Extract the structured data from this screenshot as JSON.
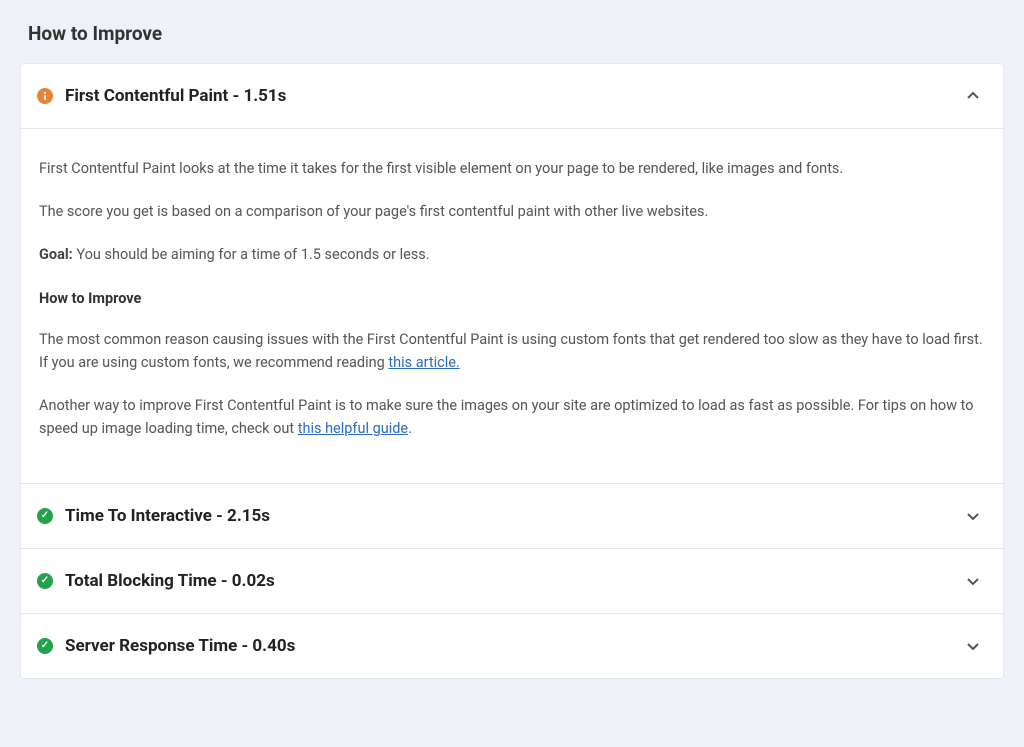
{
  "section_title": "How to Improve",
  "items": [
    {
      "status": "warn",
      "title": "First Contentful Paint - 1.51s",
      "expanded": true,
      "body": {
        "p1": "First Contentful Paint looks at the time it takes for the first visible element on your page to be rendered, like images and fonts.",
        "p2": "The score you get is based on a comparison of your page's first contentful paint with other live websites.",
        "goal_label": "Goal:",
        "goal_text": " You should be aiming for a time of 1.5 seconds or less.",
        "sub_heading": "How to Improve",
        "p3a": "The most common reason causing issues with the First Contentful Paint is using custom fonts that get rendered too slow as they have to load first. If you are using custom fonts, we recommend reading ",
        "p3_link": "this article.",
        "p4a": "Another way to improve First Contentful Paint is to make sure the images on your site are optimized to load as fast as possible. For tips on how to speed up image loading time, check out ",
        "p4_link": "this helpful guide",
        "p4b": "."
      }
    },
    {
      "status": "ok",
      "title": "Time To Interactive - 2.15s",
      "expanded": false
    },
    {
      "status": "ok",
      "title": "Total Blocking Time - 0.02s",
      "expanded": false
    },
    {
      "status": "ok",
      "title": "Server Response Time - 0.40s",
      "expanded": false
    }
  ]
}
